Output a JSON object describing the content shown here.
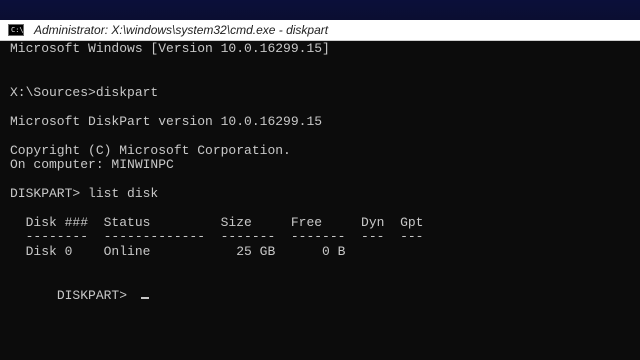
{
  "window": {
    "title": "Administrator: X:\\windows\\system32\\cmd.exe - diskpart",
    "icon_label": "C:\\",
    "icon_name": "cmd-icon"
  },
  "console": {
    "lines": {
      "l1": "Microsoft Windows [Version 10.0.16299.15]",
      "l2": "X:\\Sources>diskpart",
      "l3": "Microsoft DiskPart version 10.0.16299.15",
      "l4": "Copyright (C) Microsoft Corporation.",
      "l5": "On computer: MINWINPC",
      "l6": "DISKPART> list disk",
      "l7": "  Disk ###  Status         Size     Free     Dyn  Gpt",
      "l8": "  --------  -------------  -------  -------  ---  ---",
      "l9": "  Disk 0    Online           25 GB      0 B",
      "l10": "DISKPART> "
    }
  },
  "colors": {
    "console_bg": "#0c0c0c",
    "console_text": "#c8c8c8",
    "titlebar_bg": "#ffffff"
  }
}
